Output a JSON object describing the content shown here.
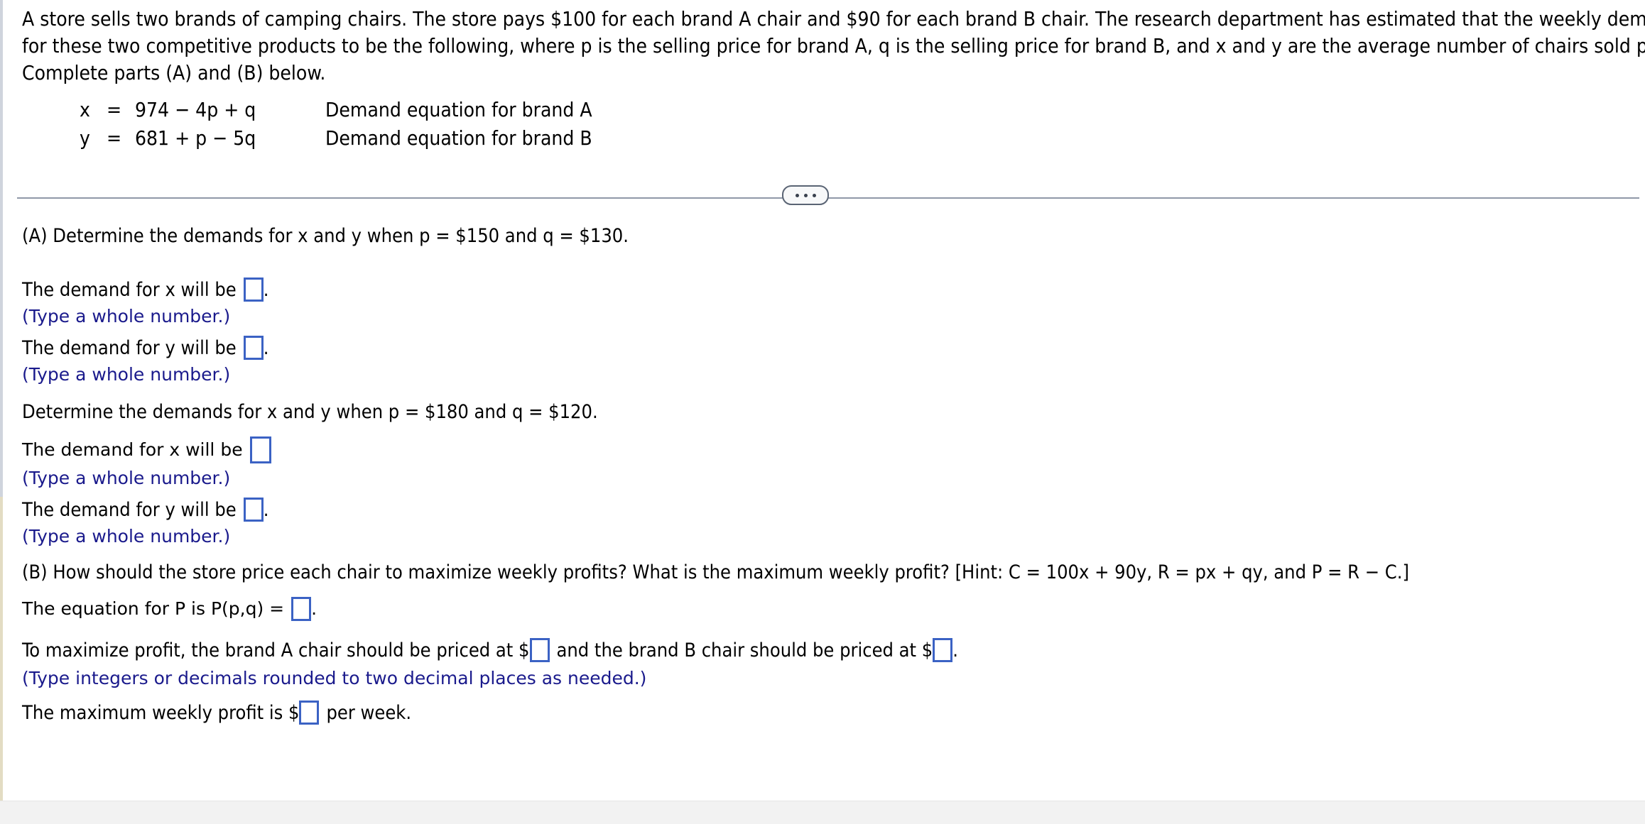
{
  "problem": {
    "statement_lines": [
      "A store sells two brands of camping chairs. The store pays $100 for each brand A chair and $90 for each brand B chair. The research department has estimated that the weekly demand equations",
      "for these two competitive products to be the following, where p is the selling price for brand A, q is the selling price for brand B, and x and y are the average number of chairs sold per week.",
      "Complete parts (A) and (B) below."
    ],
    "equations": [
      {
        "var": "x",
        "eq": "=",
        "rhs": "974 − 4p + q",
        "label": "Demand equation for brand A"
      },
      {
        "var": "y",
        "eq": "=",
        "rhs": "681 + p − 5q",
        "label": "Demand equation for brand B"
      }
    ]
  },
  "divider": {
    "more_button": "•••"
  },
  "parts": {
    "a": {
      "prompt1": "(A) Determine the demands for x and y when p = $150 and q = $130.",
      "x_label_1": "The demand for x will be",
      "x_period_1": ".",
      "x_hint_1": "(Type a whole number.)",
      "y_label_1": "The demand for y will be",
      "y_period_1": ".",
      "y_hint_1": "(Type a whole number.)",
      "prompt2": "Determine the demands for x and y when p = $180 and q = $120.",
      "x_label_2": "The demand for x will be",
      "x_hint_2": "(Type a whole number.)",
      "y_label_2": "The demand for y will be",
      "y_period_2": ".",
      "y_hint_2": "(Type a whole number.)"
    },
    "b": {
      "prompt": "(B) How should the store price each chair to maximize weekly profits? What is the maximum weekly profit? [Hint: C = 100x + 90y, R = px + qy, and P = R − C.]",
      "equation_label": "The equation for P is P(p,q) =",
      "equation_period": ".",
      "price_label_lead": "To maximize profit, the brand A chair should be priced at $",
      "price_label_mid": "and the brand B chair should be priced at $",
      "price_period": ".",
      "price_hint": "(Type integers or decimals rounded to two decimal places as needed.)",
      "profit_lead": "The maximum weekly profit is $",
      "profit_trail": "per week."
    }
  },
  "colors": {
    "hint": "#1a1a8c",
    "answer_box_border": "#3b62c4",
    "divider": "#8f98a8",
    "pill_border": "#5a6474"
  }
}
